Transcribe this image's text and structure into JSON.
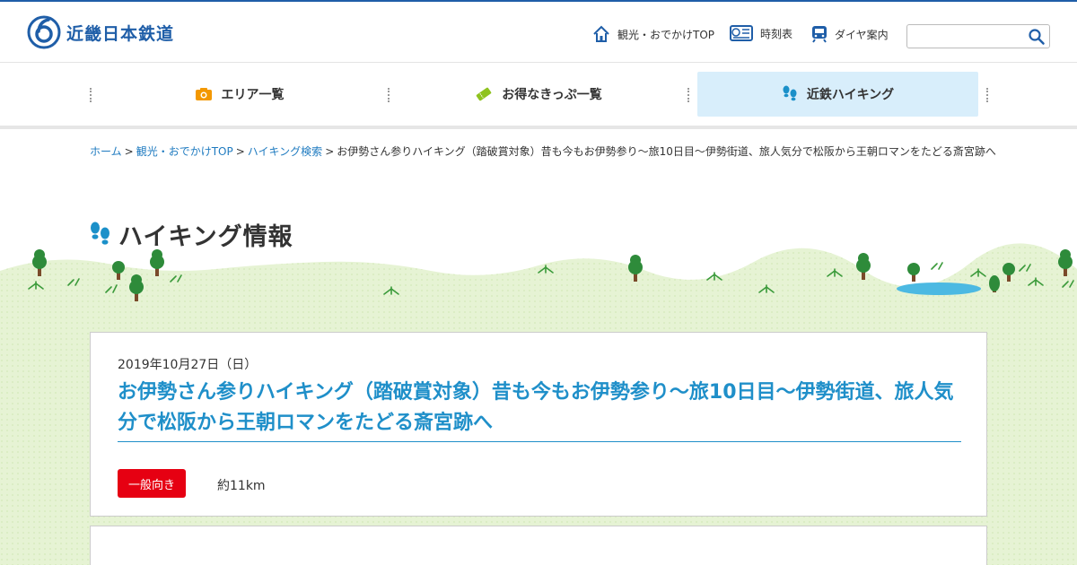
{
  "brand": {
    "name": "近畿日本鉄道",
    "color": "#1f5ea8"
  },
  "header": {
    "links": [
      {
        "label": "観光・おでかけTOP",
        "icon": "home-icon"
      },
      {
        "label": "時刻表",
        "icon": "timetable-icon"
      },
      {
        "label": "ダイヤ案内",
        "icon": "train-icon"
      }
    ],
    "search": {
      "value": "",
      "placeholder": "",
      "icon": "search-icon"
    }
  },
  "nav": {
    "items": [
      {
        "label": "エリア一覧",
        "icon": "camera-icon",
        "accent": "#f39800"
      },
      {
        "label": "お得なきっぷ一覧",
        "icon": "ticket-icon",
        "accent": "#8fc31f"
      },
      {
        "label": "近鉄ハイキング",
        "icon": "footprints-icon",
        "accent": "#1b90c9",
        "active": true
      }
    ]
  },
  "breadcrumb": {
    "items": [
      {
        "label": "ホーム"
      },
      {
        "label": "観光・おでかけTOP"
      },
      {
        "label": "ハイキング検索"
      }
    ],
    "separator": ">",
    "current": "お伊勢さん参りハイキング（踏破賞対象）昔も今もお伊勢参り～旅10日目～伊勢街道、旅人気分で松阪から王朝ロマンをたどる斎宮跡へ"
  },
  "page": {
    "title": "ハイキング情報",
    "title_icon": "footprints-icon"
  },
  "event": {
    "date": "2019年10月27日（日）",
    "title": "お伊勢さん参りハイキング（踏破賞対象）昔も今もお伊勢参り～旅10日目～伊勢街道、旅人気分で松阪から王朝ロマンをたどる斎宮跡へ",
    "level": "一般向き",
    "level_color": "#e60012",
    "distance": "約11km",
    "title_color": "#1f8fc9"
  }
}
